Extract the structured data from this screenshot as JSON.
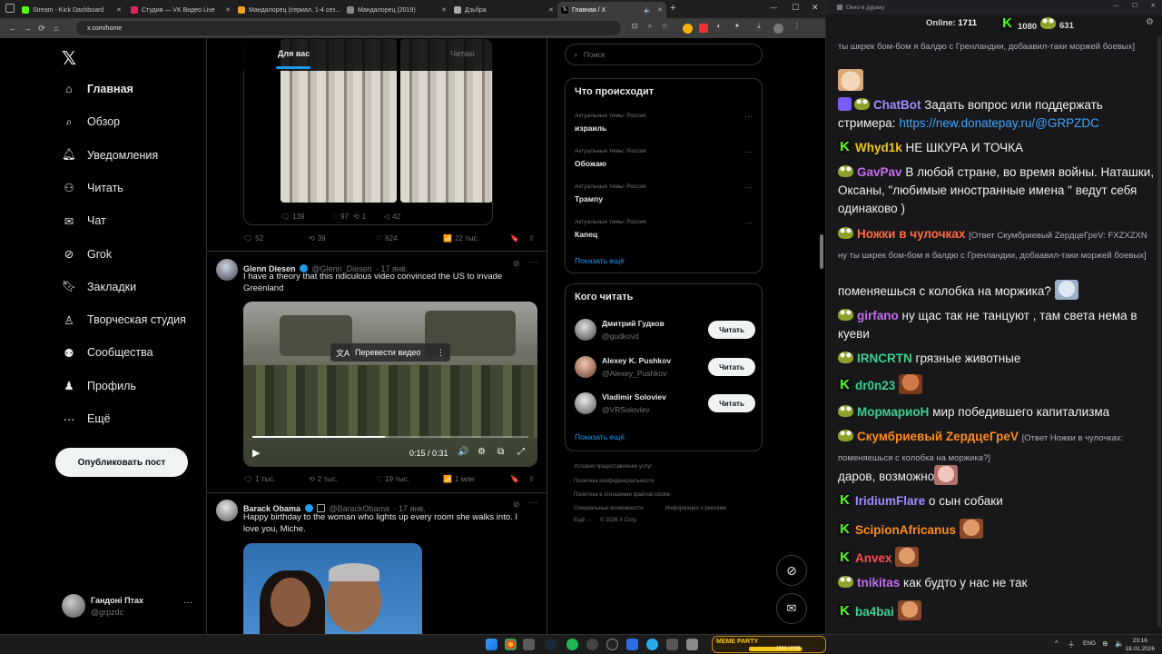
{
  "browser": {
    "tabs": [
      {
        "title": "Stream - Kick Dashboard",
        "color": "#53fc18"
      },
      {
        "title": "Студия — VK Видео Live",
        "color": "#e0245e"
      },
      {
        "title": "Мандалорец (сериал, 1-4 сез...",
        "color": "#f0a020"
      },
      {
        "title": "Мандалорец (2019)",
        "color": "#888888"
      },
      {
        "title": "Дзьбра",
        "color": "#aaaaaa"
      },
      {
        "title": "Главная / X",
        "color": "#ffffff"
      }
    ],
    "url": "x.com/home"
  },
  "x_nav": {
    "items": [
      {
        "label": "Главная",
        "icon": "home-icon"
      },
      {
        "label": "Обзор",
        "icon": "search-icon"
      },
      {
        "label": "Уведомления",
        "icon": "bell-icon"
      },
      {
        "label": "Читать",
        "icon": "add-user-icon"
      },
      {
        "label": "Чат",
        "icon": "mail-icon"
      },
      {
        "label": "Grok",
        "icon": "grok-icon"
      },
      {
        "label": "Закладки",
        "icon": "bookmark-icon"
      },
      {
        "label": "Творческая студия",
        "icon": "studio-icon"
      },
      {
        "label": "Сообщества",
        "icon": "communities-icon"
      },
      {
        "label": "Профиль",
        "icon": "profile-icon"
      },
      {
        "label": "Ещё",
        "icon": "more-icon"
      }
    ],
    "post_button": "Опубликовать пост",
    "account_name": "Гандоні Птах",
    "account_handle": "@grpzdc"
  },
  "feed": {
    "tabs": [
      "Для вас",
      "Читаю"
    ],
    "post1": {
      "replies": "139",
      "reposts": "97",
      "likes": "1",
      "views": "42"
    },
    "post1_outer": {
      "replies": "52",
      "reposts": "39",
      "likes": "624",
      "views": "22 тыс."
    },
    "post2": {
      "name": "Glenn Diesen",
      "handle": "@Glenn_Diesen",
      "date": "· 17 янв.",
      "text": "I have a theory that this ridiculous video convinced the US to invade Greenland",
      "translate_label": "Перевести видео",
      "time": "0:15 / 0:31",
      "progress": 0.48,
      "replies": "1 тыс.",
      "reposts": "2 тыс.",
      "likes": "19 тыс.",
      "views": "1 млн"
    },
    "post3": {
      "name": "Barack Obama",
      "handle": "@BarackObama",
      "date": "· 17 янв.",
      "text": "Happy birthday to the woman who lights up every room she walks into. I love you, Miche."
    }
  },
  "right": {
    "search_placeholder": "Поиск",
    "trends_title": "Что происходит",
    "trends": [
      {
        "meta": "Актуальные темы: Россия",
        "name": "израиль"
      },
      {
        "meta": "Актуальные темы: Россия",
        "name": "Обожаю"
      },
      {
        "meta": "Актуальные темы: Россия",
        "name": "Трампу"
      },
      {
        "meta": "Актуальные темы: Россия",
        "name": "Капец"
      }
    ],
    "show_more": "Показать ещё",
    "who_title": "Кого читать",
    "who": [
      {
        "name": "Дмитрий Гудков",
        "handle": "@gudkovd"
      },
      {
        "name": "Alexey K. Pushkov",
        "handle": "@Alexey_Pushkov"
      },
      {
        "name": "Vladimir Soloviev",
        "handle": "@VRSoloviev"
      }
    ],
    "follow_label": "Читать",
    "footer": [
      "Условия предоставления услуг",
      "Политика конфиденциальности",
      "Политика в отношении файлов cookie",
      "Специальные возможности",
      "Информация о рекламе",
      "Ещё ···",
      "© 2026 X Corp."
    ]
  },
  "chat": {
    "window_title": "Окно в дураку",
    "online_label": "Online:",
    "online": "1711",
    "followers": "1080",
    "subs": "631",
    "messages": [
      {
        "user": "",
        "text": "ты шкрек бом-бом я балдю с Гренландии, добаавил-таки моржей боевых]",
        "color": "#adadb8"
      },
      {
        "user": "ChatBot",
        "text": "Задать вопрос или поддержать стримера:",
        "link": "https://new.donatepay.ru/@GRPZDC",
        "color": "#9b8cff"
      },
      {
        "user": "Whyd1k",
        "text": "НЕ ШКУРА И ТОЧКА",
        "color": "#f0c419"
      },
      {
        "user": "GavPav",
        "text": "В любой стране, во время войны. Наташки, Оксаны, \"любимые иностранные имена \" ведут себя одинаково )",
        "color": "#c56cf0"
      },
      {
        "user": "Ножки в чулочках",
        "reply": "[Ответ Скумбриевый ZердцеГреV: FXZXZXN ну ты шкрек бом-бом я балдю с Гренландии, добаавил-таки моржей боевых]",
        "text": "поменяешься с колобка на моржика?",
        "color": "#ff6a3d"
      },
      {
        "user": "girfano",
        "text": "ну щас так не танцуют , там света нема в куеви",
        "color": "#c56cf0"
      },
      {
        "user": "IRNCRTN",
        "text": "грязные животные",
        "color": "#3ecf8e"
      },
      {
        "user": "dr0n23",
        "text": "",
        "color": "#3ecf8e"
      },
      {
        "user": "МормариоН",
        "text": "мир победившего капитализма",
        "color": "#3ecf8e"
      },
      {
        "user": "Скумбриевый ZердцеГреV",
        "reply": "[Ответ Ножки в чулочках: поменяешься с колобка на моржика?]",
        "text": "даров, возможно",
        "color": "#ff8c1a"
      },
      {
        "user": "IridiumFlare",
        "text": "о сын собаки",
        "color": "#9b8cff"
      },
      {
        "user": "ScipionAfricanus",
        "text": "",
        "color": "#ff8c1a"
      },
      {
        "user": "Anvex",
        "text": "",
        "color": "#ff4d4d"
      },
      {
        "user": "tnikitas",
        "text": "как будто у нас не так",
        "color": "#c56cf0"
      },
      {
        "user": "ba4bai",
        "text": "",
        "color": "#3ecf8e"
      }
    ]
  },
  "taskbar": {
    "lang": "ENG",
    "time": "23:16",
    "date": "18.01.2026",
    "meme_label": "MEME PARTY",
    "meme_count": "1550 / 1599"
  }
}
